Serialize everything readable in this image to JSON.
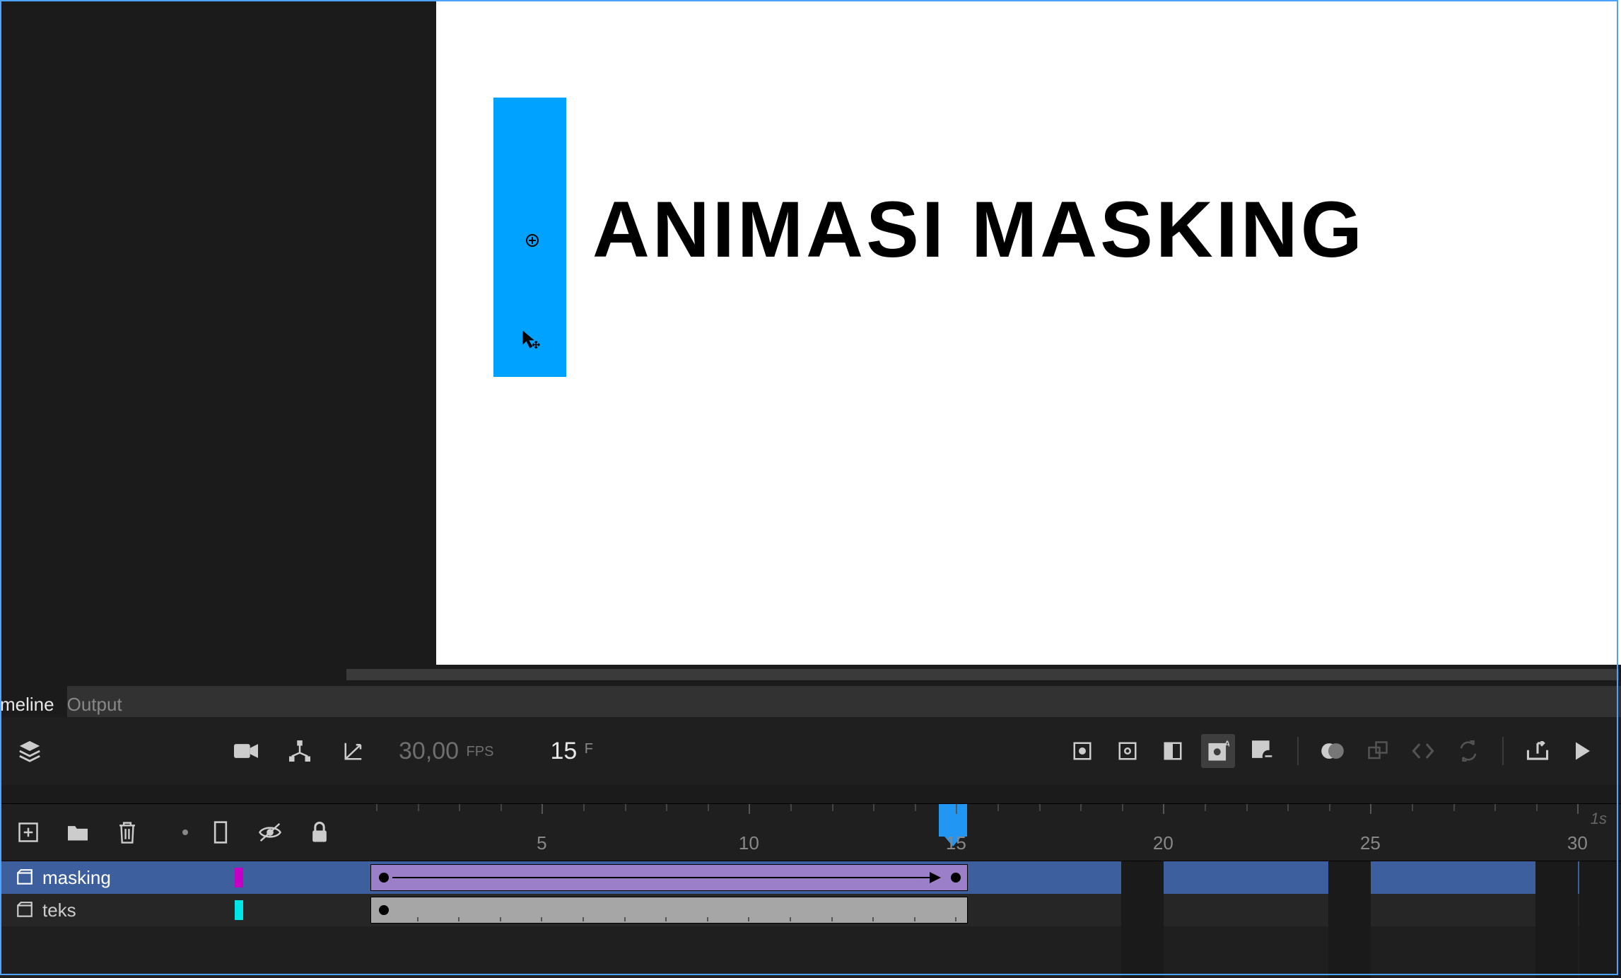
{
  "tabs": {
    "timeline": "meline",
    "output": "Output"
  },
  "fps": {
    "value": "30,00",
    "label": "FPS"
  },
  "frame": {
    "value": "15",
    "label": "F"
  },
  "ruler": {
    "marks": [
      "5",
      "10",
      "15",
      "20",
      "25",
      "30"
    ],
    "second_label": "1s"
  },
  "layers": [
    {
      "name": "masking",
      "color": "#c400c4"
    },
    {
      "name": "teks",
      "color": "#00e5e5"
    }
  ],
  "canvas": {
    "text": "ANIMASI MASKING"
  }
}
